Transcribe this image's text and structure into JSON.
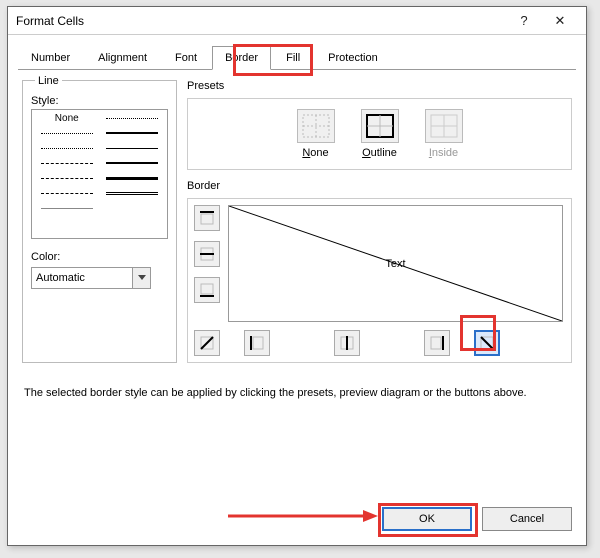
{
  "dialog": {
    "title": "Format Cells",
    "help_icon": "?",
    "close_icon": "✕"
  },
  "tabs": [
    "Number",
    "Alignment",
    "Font",
    "Border",
    "Fill",
    "Protection"
  ],
  "active_tab": "Border",
  "line": {
    "group_label": "Line",
    "style_label": "Style:",
    "none_label": "None",
    "color_label": "Color:",
    "color_value": "Automatic"
  },
  "right": {
    "presets_label": "Presets",
    "presets": [
      {
        "label": "None",
        "underline": "N"
      },
      {
        "label": "Outline",
        "underline": "O"
      },
      {
        "label": "Inside",
        "underline": "I",
        "disabled": true
      }
    ],
    "border_label": "Border",
    "preview_text": "Text"
  },
  "hint_text": "The selected border style can be applied by clicking the presets, preview diagram or the buttons above.",
  "footer": {
    "ok": "OK",
    "cancel": "Cancel"
  }
}
